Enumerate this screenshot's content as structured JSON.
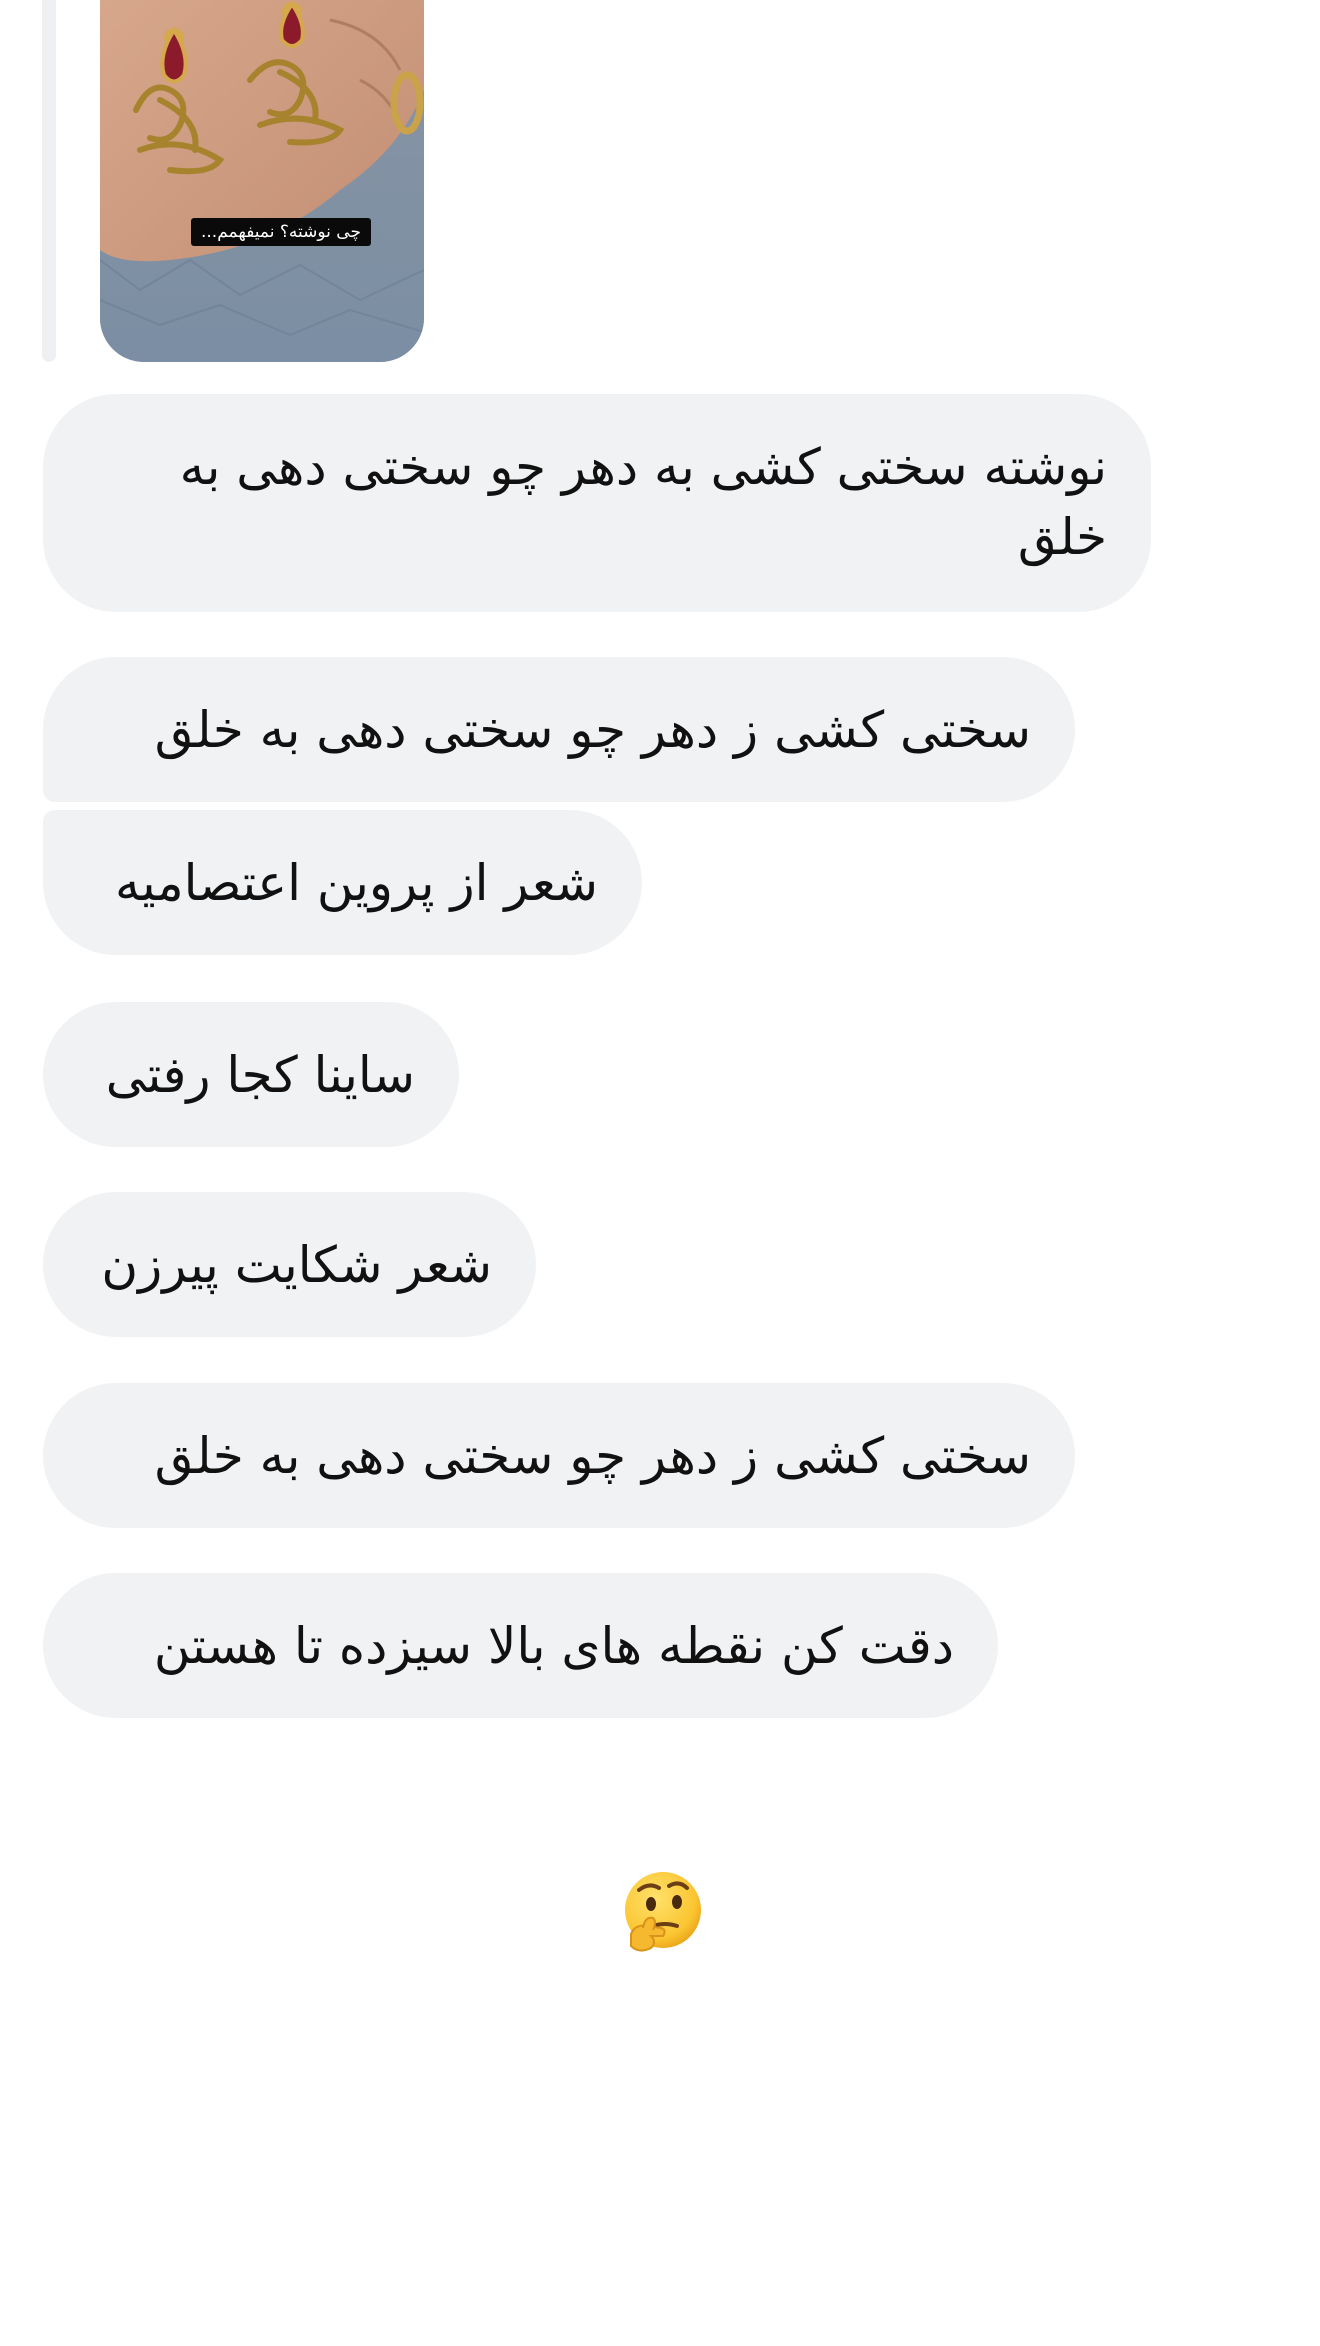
{
  "story_reply": {
    "caption": "چی نوشته؟ نمیفهمم...",
    "image_icon": "story-photo-earrings-icon"
  },
  "messages": [
    {
      "text": "نوشته سختی کشی به دهر چو سختی دهی به خلق"
    },
    {
      "text": "سختی کشی ز دهر چو سختی دهی به خلق"
    },
    {
      "text": "شعر از پروین اعتصامیه"
    },
    {
      "text": "ساینا کجا رفتی"
    },
    {
      "text": "شعر شکایت پیرزن"
    },
    {
      "text": "سختی کشی ز دهر چو سختی دهی به خلق"
    },
    {
      "text": "دقت کن نقطه های بالا سیزده تا هستن"
    }
  ],
  "reaction": {
    "icon": "thinking-face-emoji-icon"
  },
  "colors": {
    "bubble_background": "#f1f2f4",
    "text": "#111111",
    "reply_bar": "#eef0f2"
  }
}
